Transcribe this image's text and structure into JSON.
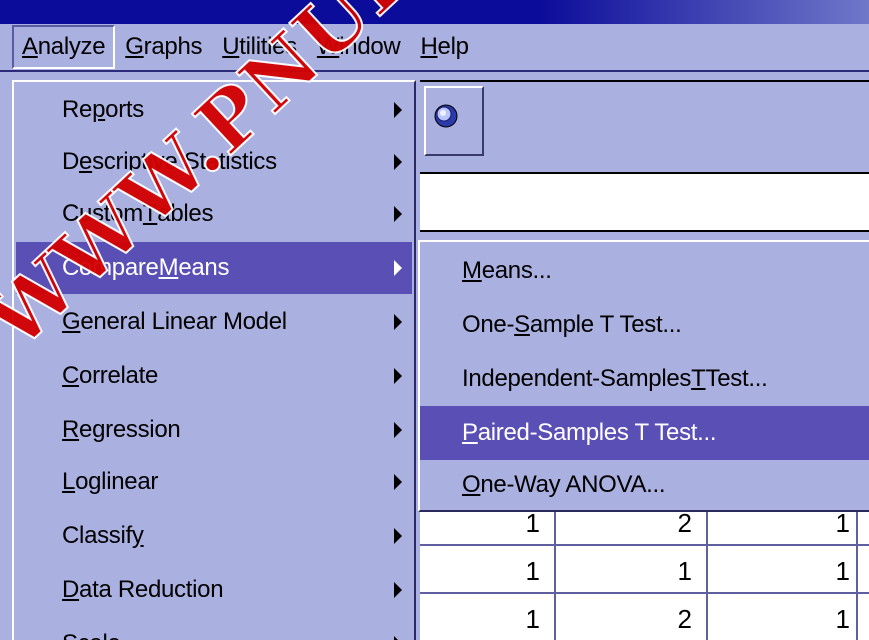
{
  "menubar": {
    "items": [
      {
        "label": "Analyze",
        "u": "A",
        "rest": "nalyze"
      },
      {
        "label": "Graphs",
        "u": "G",
        "rest": "raphs"
      },
      {
        "label": "Utilities",
        "u": "U",
        "rest": "tilities"
      },
      {
        "label": "Window",
        "u": "W",
        "rest": "indow"
      },
      {
        "label": "Help",
        "u": "H",
        "rest": "elp"
      }
    ]
  },
  "analyze_menu": {
    "items": [
      {
        "pre": "Re",
        "u": "p",
        "post": "orts"
      },
      {
        "pre": "D",
        "u": "e",
        "post": "scriptive Statistics"
      },
      {
        "pre": "Custom ",
        "u": "T",
        "post": "ables"
      },
      {
        "pre": "Compare ",
        "u": "M",
        "post": "eans"
      },
      {
        "pre": "",
        "u": "G",
        "post": "eneral Linear Model"
      },
      {
        "pre": "",
        "u": "C",
        "post": "orrelate"
      },
      {
        "pre": "",
        "u": "R",
        "post": "egression"
      },
      {
        "pre": "",
        "u": "L",
        "post": "oglinear"
      },
      {
        "pre": "Classif",
        "u": "y",
        "post": ""
      },
      {
        "pre": "",
        "u": "D",
        "post": "ata Reduction"
      },
      {
        "pre": "Scale",
        "u": "",
        "post": ""
      }
    ]
  },
  "compare_means_submenu": {
    "items": [
      {
        "pre": "",
        "u": "M",
        "post": "eans..."
      },
      {
        "pre": "One-",
        "u": "S",
        "post": "ample T Test..."
      },
      {
        "pre": "Independent-Samples ",
        "u": "T",
        "post": " Test..."
      },
      {
        "pre": "",
        "u": "P",
        "post": "aired-Samples T Test..."
      },
      {
        "pre": "",
        "u": "O",
        "post": "ne-Way ANOVA..."
      }
    ]
  },
  "data_grid": {
    "rows": [
      [
        "1",
        "2",
        "1"
      ],
      [
        "1",
        "1",
        "1"
      ],
      [
        "1",
        "2",
        "1"
      ]
    ]
  },
  "watermark": "WWW.PNUEB.COM",
  "colors": {
    "highlight": "#5a4fb4",
    "menu_bg": "#aab0e0",
    "title_bar": "#0c0c9a"
  }
}
